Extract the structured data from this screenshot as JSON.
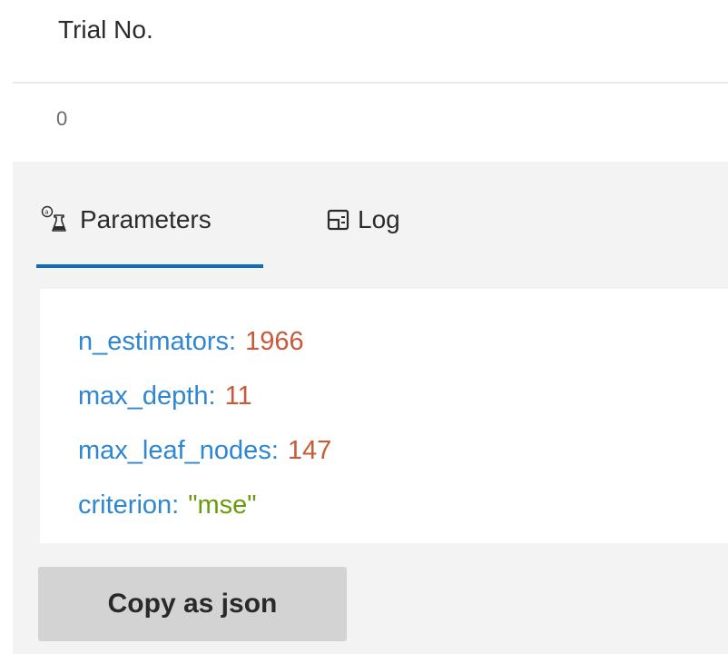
{
  "table": {
    "header": "Trial No.",
    "value": "0"
  },
  "tabs": [
    {
      "label": "Parameters",
      "icon": "parameters-icon",
      "active": true
    },
    {
      "label": "Log",
      "icon": "log-icon",
      "active": false
    }
  ],
  "parameters": [
    {
      "key": "n_estimators",
      "value": "1966",
      "type": "number"
    },
    {
      "key": "max_depth",
      "value": "11",
      "type": "number"
    },
    {
      "key": "max_leaf_nodes",
      "value": "147",
      "type": "number"
    },
    {
      "key": "criterion",
      "value": "\"mse\"",
      "type": "string"
    }
  ],
  "copy_button": {
    "label": "Copy as json"
  },
  "colors": {
    "accent": "#0f6cbd",
    "key": "#2f86d1",
    "number": "#c85a37",
    "string": "#6a9b0e",
    "panel_bg": "#f3f3f3",
    "button_bg": "#d3d3d3"
  }
}
